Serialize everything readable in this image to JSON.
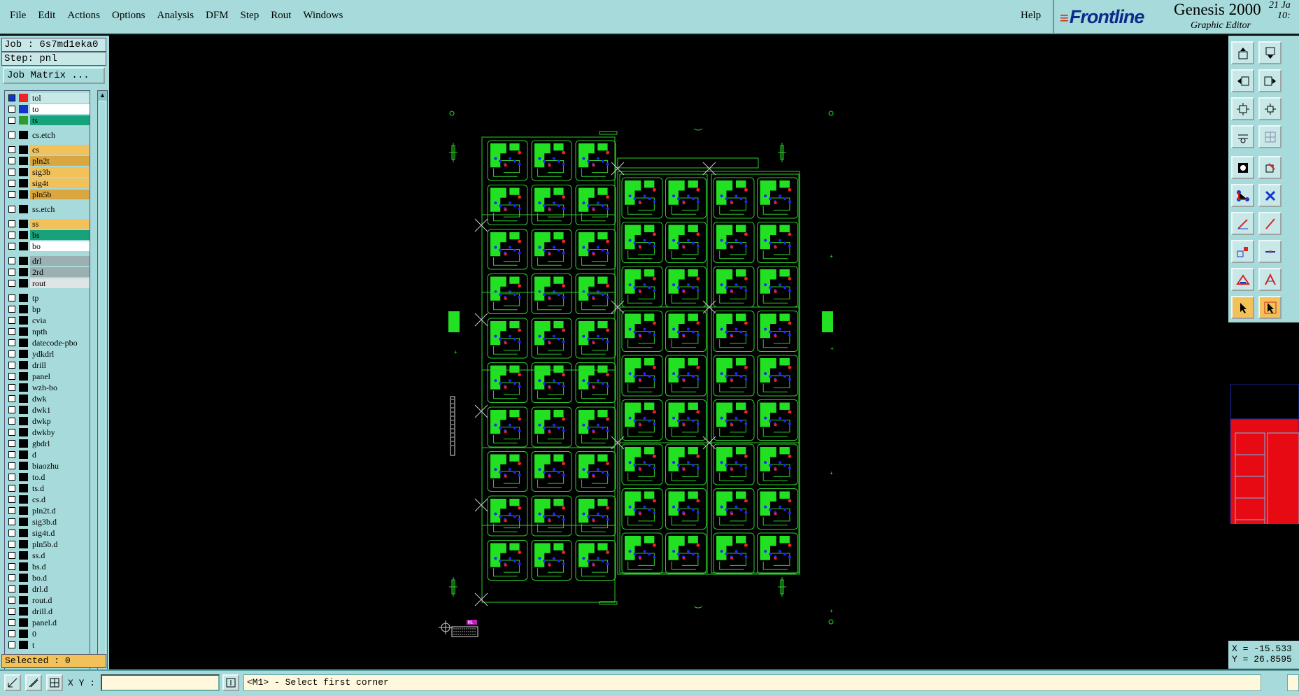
{
  "menu": {
    "items": [
      "File",
      "Edit",
      "Actions",
      "Options",
      "Analysis",
      "DFM",
      "Step",
      "Rout",
      "Windows"
    ],
    "help": "Help"
  },
  "brand": {
    "logo": "Frontline",
    "product": "Genesis 2000",
    "subtitle": "Graphic Editor",
    "date_line1": "21 Ja",
    "date_line2": "10:"
  },
  "job": {
    "job_label": "Job : 6s7md1eka0",
    "step_label": "Step: pnl",
    "matrix_button": "Job Matrix ..."
  },
  "layers": [
    {
      "name": "tol",
      "swatch": "#e22",
      "bg": "#c8e8e8",
      "checked": true,
      "gap": false
    },
    {
      "name": "to",
      "swatch": "#1233cc",
      "bg": "#ffffff",
      "gap": false
    },
    {
      "name": "ts",
      "swatch": "#2c9a2c",
      "bg": "#16a37c",
      "gap": false
    },
    {
      "name": "cs.etch",
      "swatch": "#000",
      "bg": "#a7dada",
      "gap": true
    },
    {
      "name": "cs",
      "swatch": "#000",
      "bg": "#f2c15a",
      "gap": true
    },
    {
      "name": "pln2t",
      "swatch": "#000",
      "bg": "#d9a640",
      "gap": false
    },
    {
      "name": "sig3b",
      "swatch": "#000",
      "bg": "#f2c15a",
      "gap": false
    },
    {
      "name": "sig4t",
      "swatch": "#000",
      "bg": "#f2c15a",
      "gap": false
    },
    {
      "name": "pln5b",
      "swatch": "#000",
      "bg": "#d9a640",
      "gap": false
    },
    {
      "name": "ss.etch",
      "swatch": "#000",
      "bg": "#a7dada",
      "gap": true
    },
    {
      "name": "ss",
      "swatch": "#000",
      "bg": "#f2c15a",
      "gap": true
    },
    {
      "name": "bs",
      "swatch": "#000",
      "bg": "#16a37c",
      "gap": false
    },
    {
      "name": "bo",
      "swatch": "#000",
      "bg": "#ffffff",
      "gap": false
    },
    {
      "name": "drl",
      "swatch": "#000",
      "bg": "#9bb0b0",
      "gap": true
    },
    {
      "name": "2rd",
      "swatch": "#000",
      "bg": "#9bb0b0",
      "gap": false
    },
    {
      "name": "rout",
      "swatch": "#000",
      "bg": "#dfe4e4",
      "gap": false
    },
    {
      "name": "tp",
      "swatch": "#000",
      "bg": "#a7dada",
      "gap": true
    },
    {
      "name": "bp",
      "swatch": "#000",
      "bg": "#a7dada",
      "gap": false
    },
    {
      "name": "cvia",
      "swatch": "#000",
      "bg": "#a7dada",
      "gap": false
    },
    {
      "name": "npth",
      "swatch": "#000",
      "bg": "#a7dada",
      "gap": false
    },
    {
      "name": "datecode-pbo",
      "swatch": "#000",
      "bg": "#a7dada",
      "gap": false
    },
    {
      "name": "ydkdrl",
      "swatch": "#000",
      "bg": "#a7dada",
      "gap": false
    },
    {
      "name": "drill",
      "swatch": "#000",
      "bg": "#a7dada",
      "gap": false
    },
    {
      "name": "panel",
      "swatch": "#000",
      "bg": "#a7dada",
      "gap": false
    },
    {
      "name": "wzh-bo",
      "swatch": "#000",
      "bg": "#a7dada",
      "gap": false
    },
    {
      "name": "dwk",
      "swatch": "#000",
      "bg": "#a7dada",
      "gap": false
    },
    {
      "name": "dwk1",
      "swatch": "#000",
      "bg": "#a7dada",
      "gap": false
    },
    {
      "name": "dwkp",
      "swatch": "#000",
      "bg": "#a7dada",
      "gap": false
    },
    {
      "name": "dwkby",
      "swatch": "#000",
      "bg": "#a7dada",
      "gap": false
    },
    {
      "name": "gbdrl",
      "swatch": "#000",
      "bg": "#a7dada",
      "gap": false
    },
    {
      "name": "d",
      "swatch": "#000",
      "bg": "#a7dada",
      "gap": false
    },
    {
      "name": "biaozhu",
      "swatch": "#000",
      "bg": "#a7dada",
      "gap": false
    },
    {
      "name": "to.d",
      "swatch": "#000",
      "bg": "#a7dada",
      "gap": false
    },
    {
      "name": "ts.d",
      "swatch": "#000",
      "bg": "#a7dada",
      "gap": false
    },
    {
      "name": "cs.d",
      "swatch": "#000",
      "bg": "#a7dada",
      "gap": false
    },
    {
      "name": "pln2t.d",
      "swatch": "#000",
      "bg": "#a7dada",
      "gap": false
    },
    {
      "name": "sig3b.d",
      "swatch": "#000",
      "bg": "#a7dada",
      "gap": false
    },
    {
      "name": "sig4t.d",
      "swatch": "#000",
      "bg": "#a7dada",
      "gap": false
    },
    {
      "name": "pln5b.d",
      "swatch": "#000",
      "bg": "#a7dada",
      "gap": false
    },
    {
      "name": "ss.d",
      "swatch": "#000",
      "bg": "#a7dada",
      "gap": false
    },
    {
      "name": "bs.d",
      "swatch": "#000",
      "bg": "#a7dada",
      "gap": false
    },
    {
      "name": "bo.d",
      "swatch": "#000",
      "bg": "#a7dada",
      "gap": false
    },
    {
      "name": "drl.d",
      "swatch": "#000",
      "bg": "#a7dada",
      "gap": false
    },
    {
      "name": "rout.d",
      "swatch": "#000",
      "bg": "#a7dada",
      "gap": false
    },
    {
      "name": "drill.d",
      "swatch": "#000",
      "bg": "#a7dada",
      "gap": false
    },
    {
      "name": "panel.d",
      "swatch": "#000",
      "bg": "#a7dada",
      "gap": false
    },
    {
      "name": "0",
      "swatch": "#000",
      "bg": "#a7dada",
      "gap": false
    },
    {
      "name": "t",
      "swatch": "#000",
      "bg": "#a7dada",
      "gap": false
    }
  ],
  "status": {
    "selected": "Selected : 0",
    "xy_label": "X Y :",
    "xy_value": "",
    "message": "<M1> - Select first corner"
  },
  "coords": {
    "x": "X = -15.533",
    "y": "Y = 26.8595"
  },
  "canvas": {
    "board_color": "#22e022",
    "line_color": "#2ccc2c",
    "via_color": "#2222ff",
    "marker_label": "M1"
  },
  "tools": [
    {
      "name": "panel-up-icon"
    },
    {
      "name": "panel-down-icon"
    },
    {
      "name": "panel-left-icon"
    },
    {
      "name": "panel-right-icon"
    },
    {
      "name": "zoom-fit-icon"
    },
    {
      "name": "zoom-home-icon"
    },
    {
      "name": "measure-icon"
    },
    {
      "name": "grid-icon"
    },
    {
      "name": "snap-icon"
    },
    {
      "name": "draw-rect-icon"
    },
    {
      "name": "connect-icon"
    },
    {
      "name": "delete-icon"
    },
    {
      "name": "line-icon"
    },
    {
      "name": "slash-icon"
    },
    {
      "name": "pad-icon"
    },
    {
      "name": "segment-icon"
    },
    {
      "name": "triangle-icon"
    },
    {
      "name": "arc-icon"
    },
    {
      "name": "select-icon"
    },
    {
      "name": "pointer-icon"
    }
  ]
}
